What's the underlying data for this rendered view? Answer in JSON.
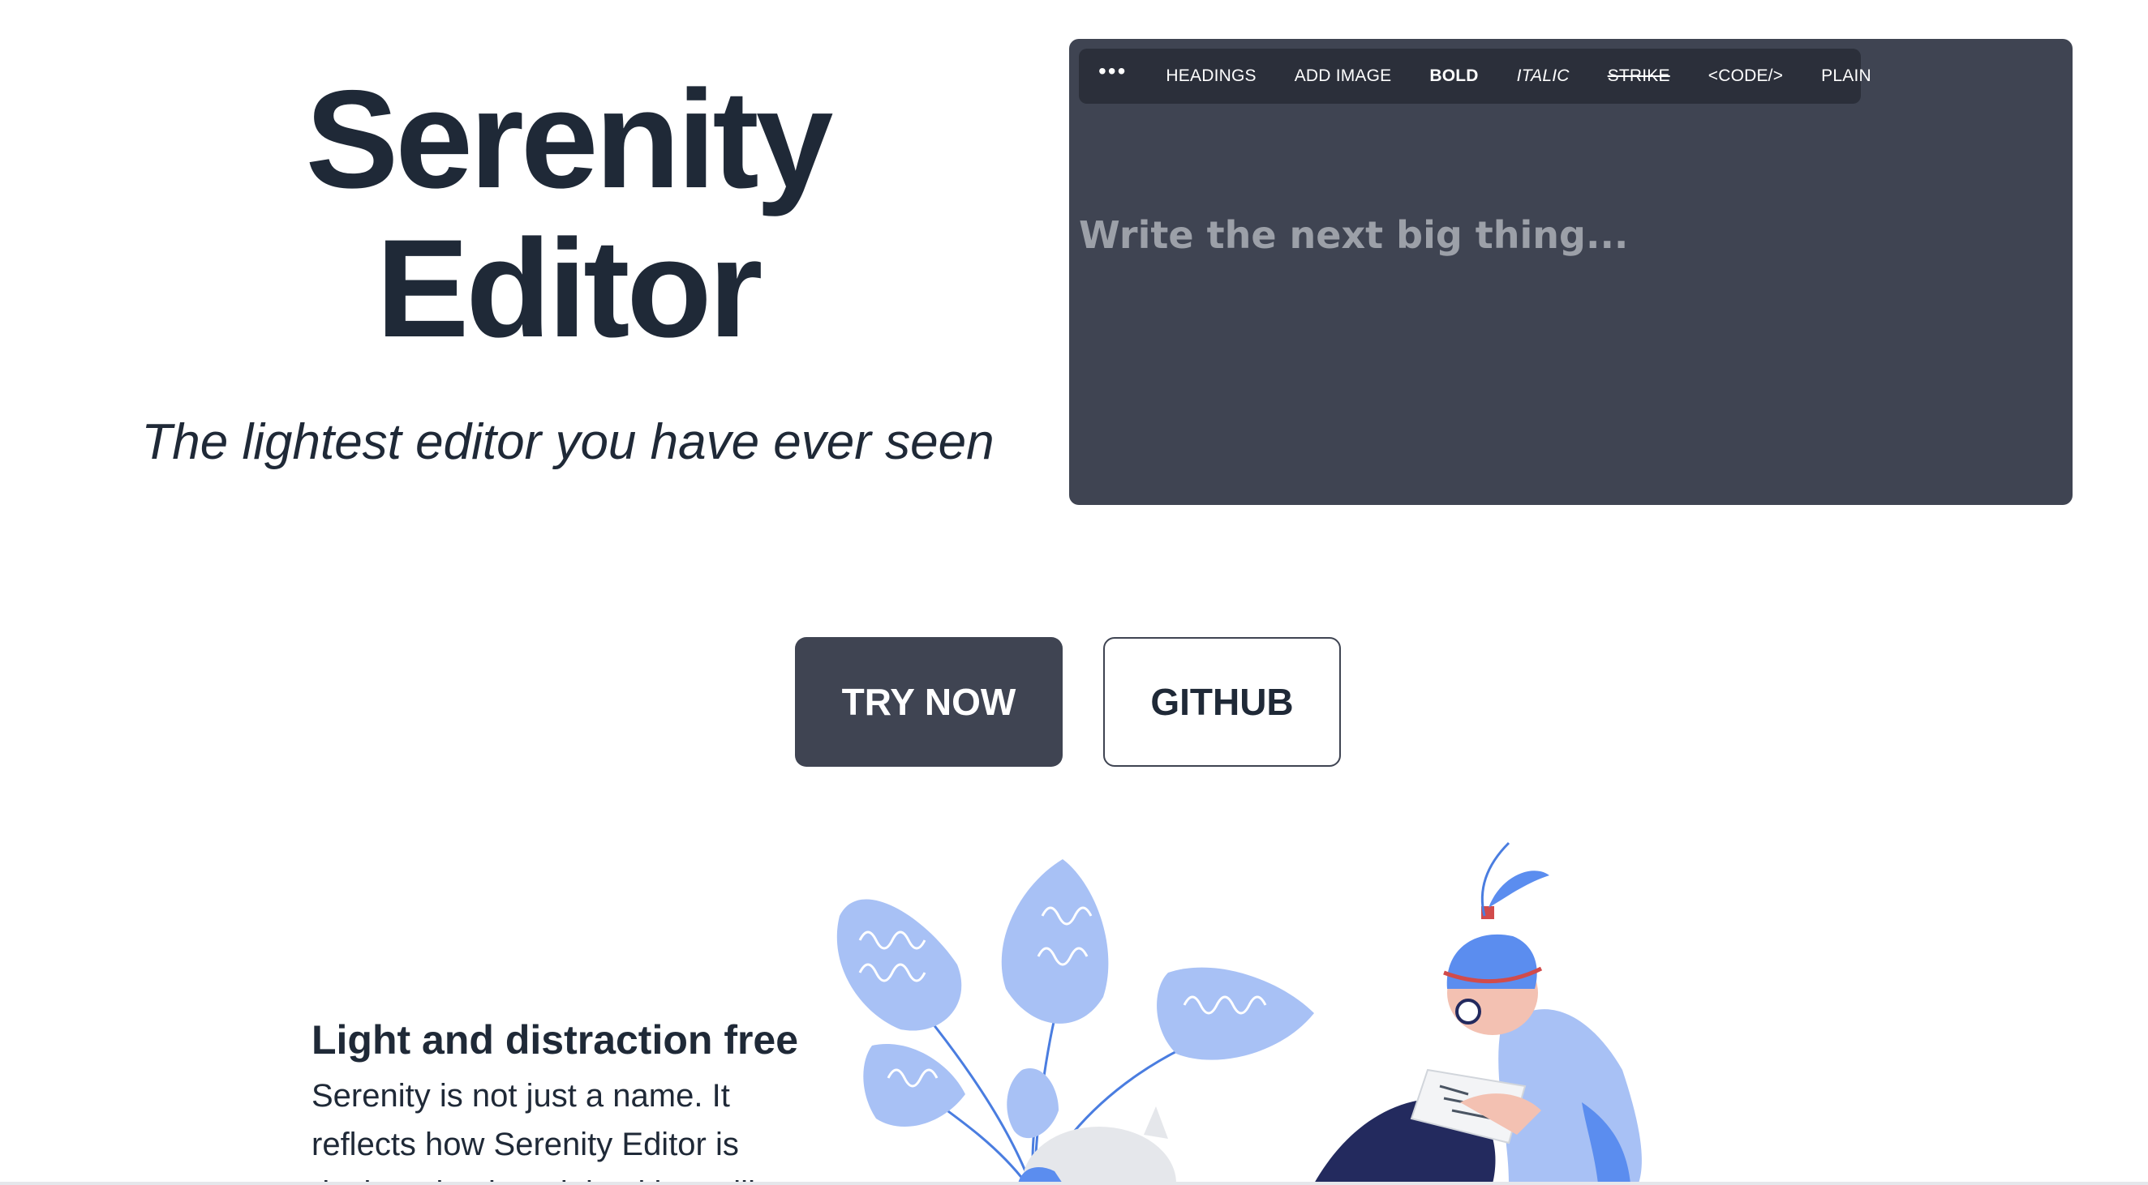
{
  "hero": {
    "title_line1": "Serenity",
    "title_line2": "Editor",
    "tagline": "The lightest editor you have ever seen"
  },
  "editor": {
    "toolbar": {
      "more": "•••",
      "headings": "HEADINGS",
      "add_image": "ADD IMAGE",
      "bold": "BOLD",
      "italic": "ITALIC",
      "strike": "STRIKE",
      "code": "<CODE/>",
      "plain": "PLAIN"
    },
    "placeholder": "Write the next big thing..."
  },
  "actions": {
    "try_now": "TRY NOW",
    "github": "GITHUB"
  },
  "feature": {
    "title": "Light and distraction free",
    "text": "Serenity is not just a name. It reflects how Serenity Editor is designed to be minimal but still"
  },
  "colors": {
    "editor_bg": "#3f4452",
    "toolbar_bg": "#2b2f3a",
    "text_dark": "#1f2937",
    "illustration_blue": "#5b8def",
    "illustration_light_blue": "#a8c1f5",
    "illustration_navy": "#232a5e"
  }
}
